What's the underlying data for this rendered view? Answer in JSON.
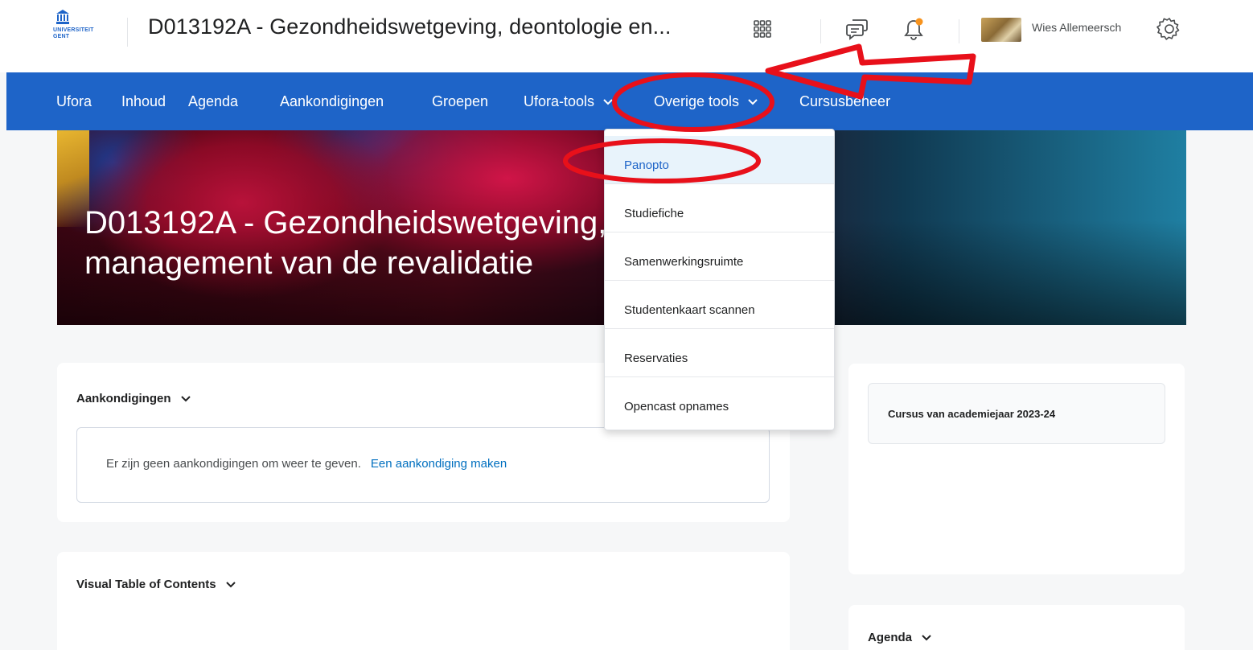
{
  "header": {
    "logo_text_line1": "UNIVERSITEIT",
    "logo_text_line2": "GENT",
    "course_title": "D013192A - Gezondheidswetgeving, deontologie en...",
    "user_name": "Wies Allemeersch",
    "icons": [
      "app-grid-icon",
      "chat-icon",
      "bell-icon",
      "gear-icon"
    ],
    "notification_dot_color": "#f7931e"
  },
  "nav": {
    "items": [
      "Ufora",
      "Inhoud",
      "Agenda",
      "Aankondigingen",
      "Groepen",
      "Ufora-tools",
      "Overige tools",
      "Cursusbeheer"
    ],
    "color": "#1e64c8"
  },
  "hero": {
    "title_line1": "D013192A - Gezondheidswetgeving, deontologie en",
    "title_line2": "management van de revalidatie"
  },
  "dropdown": {
    "items": [
      "Panopto",
      "Studiefiche",
      "Samenwerkingsruimte",
      "Studentenkaart scannen",
      "Reservaties",
      "Opencast opnames"
    ],
    "highlighted": "Panopto"
  },
  "widgets": {
    "announcements": {
      "heading": "Aankondigingen",
      "empty_text": "Er zijn geen aankondigingen om weer te geven.",
      "create_link": "Een aankondiging maken"
    },
    "toc": {
      "heading": "Visual Table of Contents"
    },
    "course_year": {
      "text": "Cursus van academiejaar 2023-24"
    },
    "agenda": {
      "heading": "Agenda"
    }
  },
  "annotation_color": "#e8101a"
}
